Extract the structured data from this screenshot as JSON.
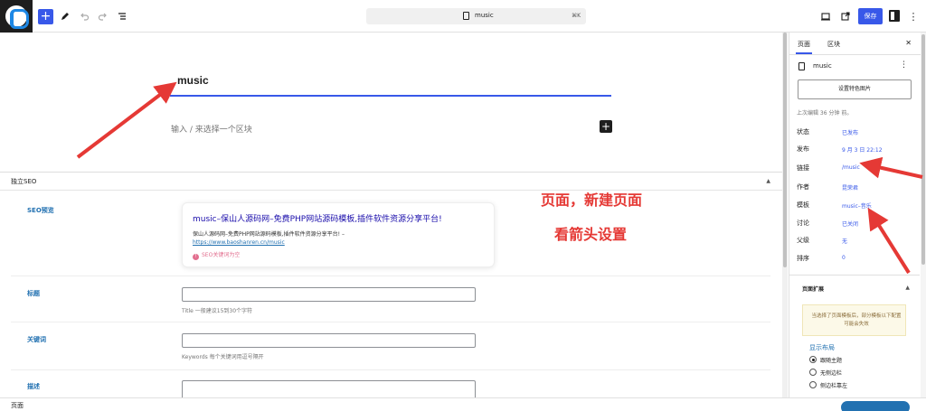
{
  "toolbar": {
    "title": "music",
    "shortcut": "⌘K",
    "save_label": "保存"
  },
  "editor": {
    "post_title": "music",
    "block_placeholder": "输入 / 来选择一个区块"
  },
  "seo": {
    "box_title": "独立SEO",
    "preview_label": "SEO预览",
    "preview_title": "music–保山人源码网–免费PHP网站源码模板,插件软件资源分享平台!",
    "preview_desc": "保山人源码网–免费PHP网站源码模板,插件软件资源分享平台! –",
    "preview_url": "https://www.baoshanren.cn/music",
    "preview_warning": "SEO关键词为空",
    "title_label": "标题",
    "title_help": "Title 一般建议15到30个字符",
    "keywords_label": "关键词",
    "keywords_help": "Keywords 每个关键词用逗号隔开",
    "desc_label": "描述"
  },
  "annotations": {
    "line1": "页面，新建页面",
    "line2": "看箭头设置"
  },
  "sidebar": {
    "tabs": [
      {
        "label": "页面",
        "active": true
      },
      {
        "label": "区块",
        "active": false
      }
    ],
    "doc_name": "music",
    "featured_image_label": "设置特色图片",
    "last_edited": "上次编辑 36 分钟 前。",
    "properties": [
      {
        "label": "状态",
        "value": "已发布"
      },
      {
        "label": "发布",
        "value": "9 月 3 日 22:12"
      },
      {
        "label": "链接",
        "value": "/music"
      },
      {
        "label": "作者",
        "value": "昆荣君"
      },
      {
        "label": "模板",
        "value": "music–音乐"
      },
      {
        "label": "讨论",
        "value": "已关闭"
      },
      {
        "label": "父级",
        "value": "无"
      },
      {
        "label": "排序",
        "value": "0"
      }
    ],
    "extension": {
      "title": "页面扩展",
      "notice": "当选择了页面模板后，部分模板以下配置可能会失效",
      "layout_title": "显示布局",
      "layout_options": [
        {
          "label": "跟随主题",
          "checked": true
        },
        {
          "label": "无侧边栏",
          "checked": false
        },
        {
          "label": "侧边栏靠左",
          "checked": false
        }
      ]
    }
  },
  "footer": {
    "breadcrumb": "页面"
  },
  "colors": {
    "accent": "#3858e9",
    "annotation": "#e53935"
  }
}
